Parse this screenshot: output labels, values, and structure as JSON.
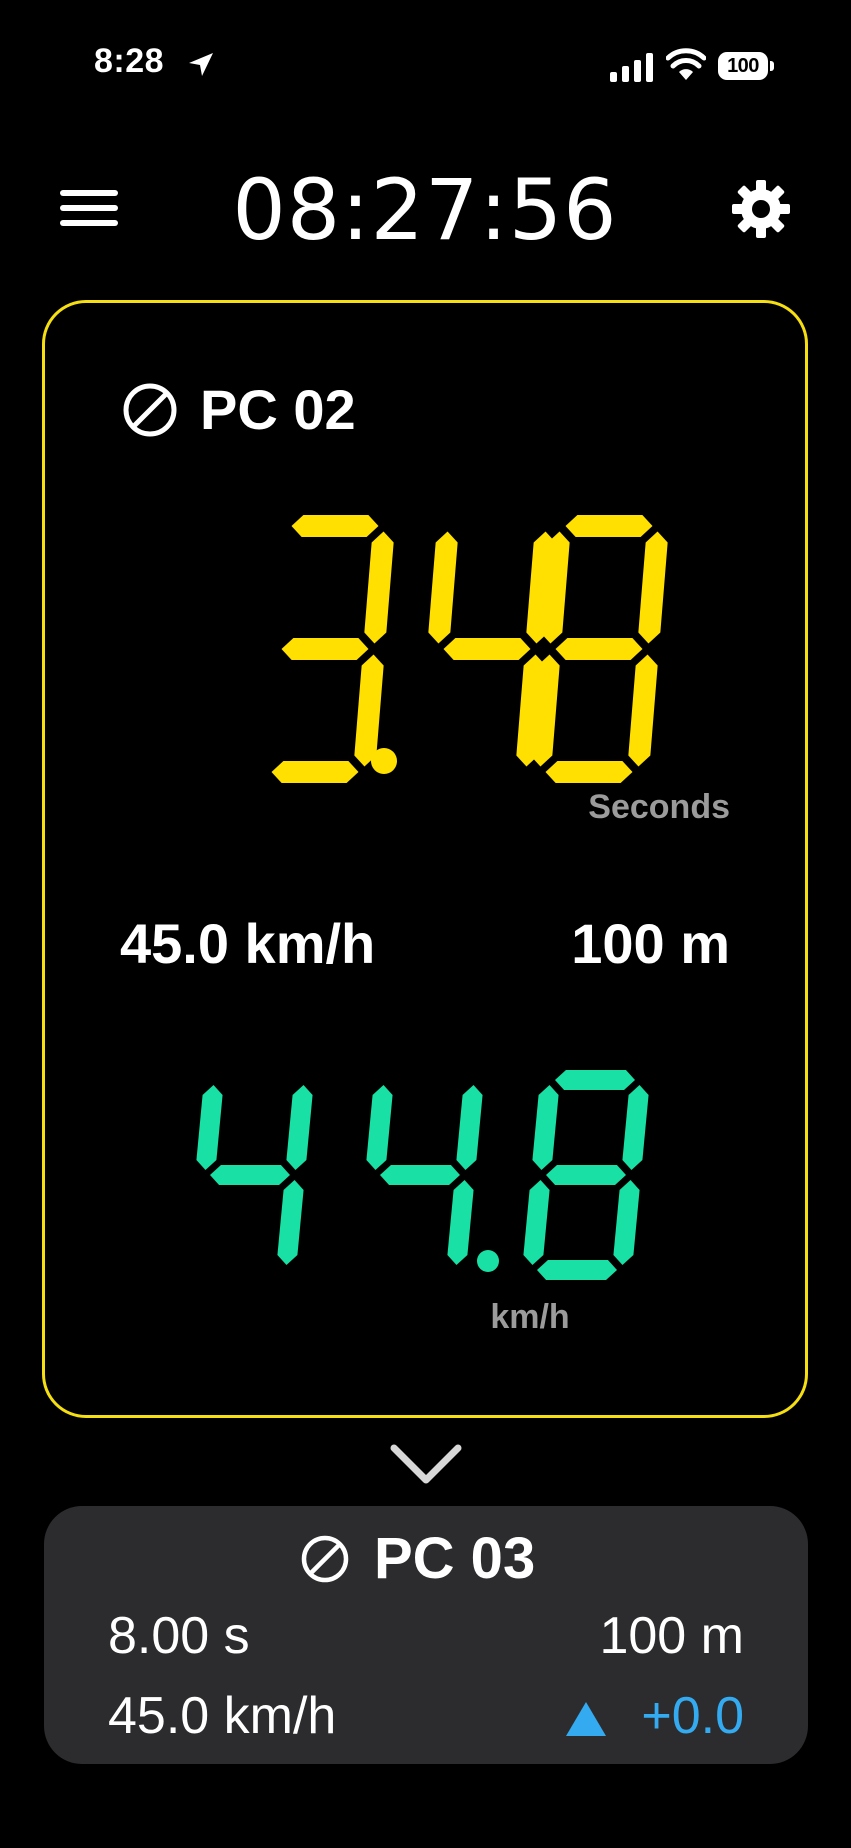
{
  "status_bar": {
    "time": "8:28",
    "battery": "100"
  },
  "header": {
    "clock": "08:27:56",
    "menu_icon": "hamburger-icon",
    "settings_icon": "gear-icon"
  },
  "current_pc": {
    "status_icon": "prohibited-icon",
    "label": "PC 02",
    "remaining_time": "3.48",
    "remaining_time_unit": "Seconds",
    "target_speed": "45.0 km/h",
    "distance": "100 m",
    "current_speed": "44.8",
    "current_speed_unit": "km/h",
    "colors": {
      "border": "#f5de12",
      "time_digits": "#ffe000",
      "speed_digits": "#19e0a4",
      "label_gray": "#9b9b9b"
    }
  },
  "expand_icon": "chevron-down-icon",
  "next_pc": {
    "status_icon": "prohibited-icon",
    "label": "PC 03",
    "time": "8.00 s",
    "distance": "100 m",
    "speed": "45.0 km/h",
    "delta_icon": "triangle-up-icon",
    "delta": "+0.0",
    "colors": {
      "background": "#2c2c2e",
      "delta": "#34aaf0"
    }
  }
}
